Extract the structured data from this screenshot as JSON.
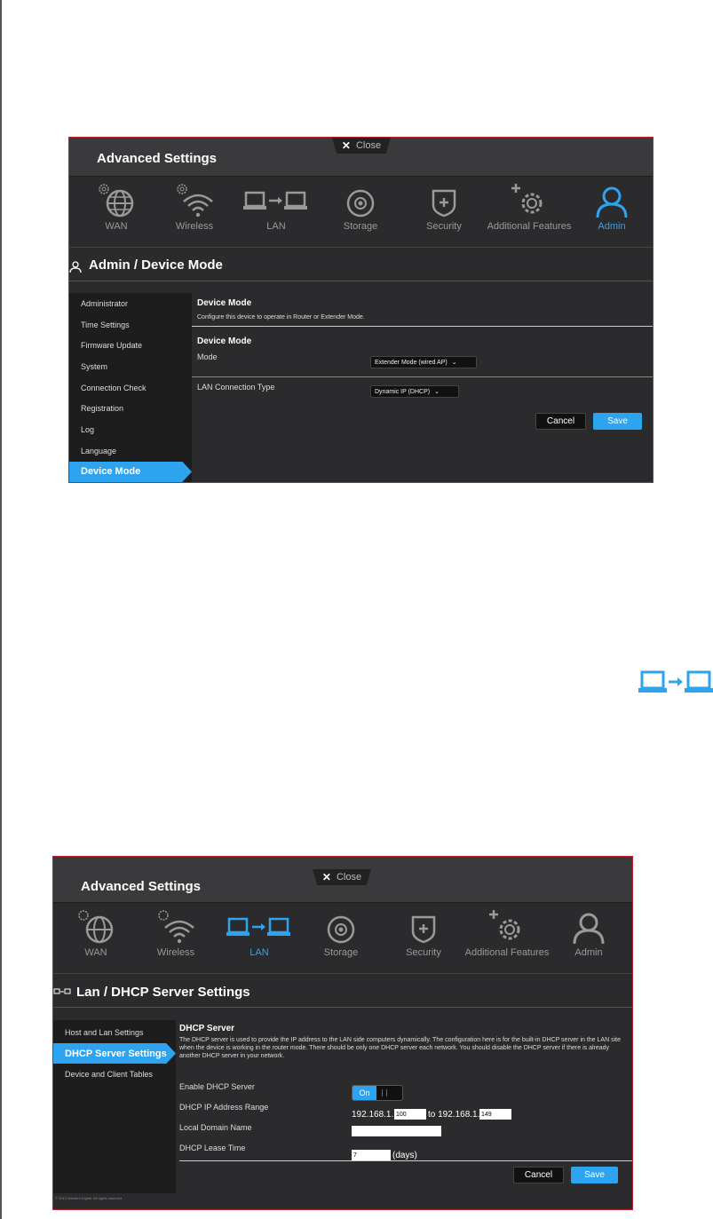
{
  "colors": {
    "accent": "#2ea4f0",
    "panel_bg": "#2b2b2d",
    "border": "#c0202a"
  },
  "screen1": {
    "close_label": "Close",
    "title": "Advanced Settings",
    "nav": [
      "WAN",
      "Wireless",
      "LAN",
      "Storage",
      "Security",
      "Additional Features",
      "Admin"
    ],
    "active_nav": "Admin",
    "page_title": "Admin / Device Mode",
    "sidebar": [
      "Administrator",
      "Time Settings",
      "Firmware Update",
      "System",
      "Connection Check",
      "Registration",
      "Log",
      "Language",
      "Device Mode"
    ],
    "active_sidebar": "Device Mode",
    "section1_title": "Device Mode",
    "section1_desc": "Configure this device to operate in Router or Extender Mode.",
    "section2_title": "Device Mode",
    "mode_label": "Mode",
    "mode_value": "Extender Mode (wired AP)",
    "lan_type_label": "LAN Connection Type",
    "lan_type_value": "Dynamic IP (DHCP)",
    "cancel": "Cancel",
    "save": "Save"
  },
  "screen2": {
    "close_label": "Close",
    "title": "Advanced Settings",
    "nav": [
      "WAN",
      "Wireless",
      "LAN",
      "Storage",
      "Security",
      "Additional Features",
      "Admin"
    ],
    "active_nav": "LAN",
    "page_title": "Lan / DHCP Server Settings",
    "sidebar": [
      "Host and Lan Settings",
      "DHCP Server Settings",
      "Device and Client Tables"
    ],
    "active_sidebar": "DHCP Server Settings",
    "section_title": "DHCP Server",
    "section_desc": "The DHCP server is used to provide the IP address to the LAN side computers dynamically. The configuration here is for the built-in DHCP server in the LAN site when the device is working in the router mode. There should be only one DHCP server each network. You should disable the DHCP server if there is already another DHCP server in your network.",
    "enable_label": "Enable DHCP Server",
    "enable_value": "On",
    "range_label": "DHCP IP Address Range",
    "range_prefix": "192.168.1.",
    "range_start": "100",
    "range_to": "to 192.168.1.",
    "range_end": "149",
    "domain_label": "Local Domain Name",
    "domain_value": "",
    "lease_label": "DHCP Lease Time",
    "lease_value": "7",
    "lease_unit": "(days)",
    "cancel": "Cancel",
    "save": "Save",
    "copyright": "© 2013 Western Digital. All rights reserved."
  }
}
